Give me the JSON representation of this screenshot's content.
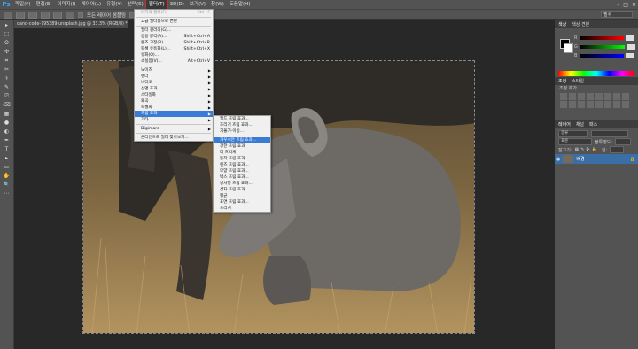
{
  "menubar": {
    "logo": "Ps",
    "items": [
      "파일(F)",
      "편집(E)",
      "이미지(I)",
      "레이어(L)",
      "유형(Y)",
      "선택(S)",
      "필터(T)",
      "3D(D)",
      "보기(V)",
      "창(W)",
      "도움말(H)"
    ],
    "active_index": 6,
    "window_controls": [
      "–",
      "□",
      "✕"
    ]
  },
  "options": {
    "text1": "모든 레이어 샘플링",
    "text2": "자동",
    "workspace": "필수"
  },
  "document": {
    "tab_title": "dand-code-795389-unsplash.jpg @ 33.3% (RGB/8) * ✕"
  },
  "filter_menu": {
    "items": [
      {
        "label": "마지막 필터(F)",
        "shortcut": "Ctrl+F",
        "disabled": true
      },
      {
        "sep": true
      },
      {
        "label": "고급 필터용으로 변환"
      },
      {
        "sep": true
      },
      {
        "label": "필터 갤러리(G)..."
      },
      {
        "label": "응용 광각(A)...",
        "shortcut": "Shift+Ctrl+A"
      },
      {
        "label": "렌즈 교정(R)...",
        "shortcut": "Shift+Ctrl+R"
      },
      {
        "label": "픽셀 유동화(L)...",
        "shortcut": "Shift+Ctrl+X"
      },
      {
        "label": "유화(O)..."
      },
      {
        "label": "소실점(V)...",
        "shortcut": "Alt+Ctrl+V"
      },
      {
        "sep": true
      },
      {
        "label": "노이즈",
        "sub": true
      },
      {
        "label": "렌더",
        "sub": true
      },
      {
        "label": "비디오",
        "sub": true
      },
      {
        "label": "선명 효과",
        "sub": true
      },
      {
        "label": "스타일화",
        "sub": true
      },
      {
        "label": "왜곡",
        "sub": true
      },
      {
        "label": "픽셀화",
        "sub": true
      },
      {
        "label": "흐림 효과",
        "sub": true,
        "highlight": true
      },
      {
        "label": "기타",
        "sub": true
      },
      {
        "sep": true
      },
      {
        "label": "Digimarc",
        "sub": true
      },
      {
        "sep": true
      },
      {
        "label": "온라인으로 필터 찾아보기..."
      }
    ]
  },
  "blur_submenu": {
    "items": [
      {
        "label": "필드 흐림 효과..."
      },
      {
        "label": "조리개 흐림 효과..."
      },
      {
        "label": "기울기-이동..."
      },
      {
        "sep": true
      },
      {
        "label": "가우시안 흐림 효과...",
        "highlight": true
      },
      {
        "label": "강한 흐림 효과"
      },
      {
        "label": "더 흐리게"
      },
      {
        "label": "동작 흐림 효과..."
      },
      {
        "label": "렌즈 흐림 효과..."
      },
      {
        "label": "모양 흐림 효과..."
      },
      {
        "label": "박스 흐림 효과..."
      },
      {
        "label": "방사형 흐림 효과..."
      },
      {
        "label": "상자 흐림 효과..."
      },
      {
        "label": "평균"
      },
      {
        "label": "표면 흐림 효과..."
      },
      {
        "label": "흐리게"
      }
    ]
  },
  "sidebar": {
    "color_tabs": [
      "색상",
      "색상 견본"
    ],
    "channels": [
      "R",
      "G",
      "B"
    ],
    "adjust_tabs": [
      "조정",
      "스타일"
    ],
    "adjust_title": "조정 추가",
    "layers_tabs": [
      "레이어",
      "채널",
      "패스"
    ],
    "layer_kind": "종류",
    "blend_mode": "표준",
    "opacity_label": "불투명도:",
    "lock_label": "잠그기:",
    "fill_label": "칠:",
    "layer_name": "배경"
  },
  "tools": [
    "▸",
    "⬚",
    "ʘ",
    "✣",
    "⌗",
    "✂",
    "⚕",
    "✎",
    "⎚",
    "⌫",
    "▦",
    "●",
    "◐",
    "✒",
    "T",
    "▸",
    "▭",
    "✋",
    "🔍",
    "⋯"
  ]
}
